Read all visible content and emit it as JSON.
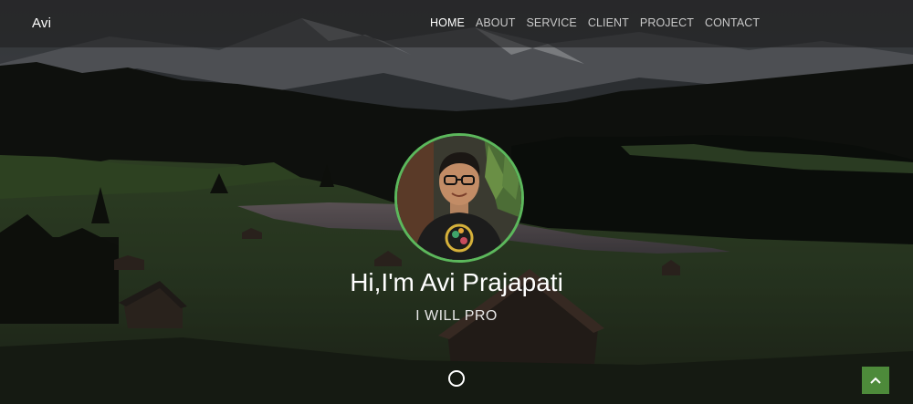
{
  "brand": "Avi",
  "nav": {
    "items": [
      {
        "label": "HOME",
        "active": true
      },
      {
        "label": "ABOUT",
        "active": false
      },
      {
        "label": "SERVICE",
        "active": false
      },
      {
        "label": "CLIENT",
        "active": false
      },
      {
        "label": "PROJECT",
        "active": false
      },
      {
        "label": "CONTACT",
        "active": false
      }
    ]
  },
  "hero": {
    "title": "Hi,I'm Avi Prajapati",
    "subtitle": "I WILL PRO"
  },
  "icons": {
    "avatar": "profile-photo",
    "scroll": "circle-icon",
    "back_to_top": "chevron-up-icon"
  },
  "colors": {
    "accent": "#5cb85c",
    "back_to_top_bg": "#4d8a3a",
    "nav_active": "#ffffff",
    "nav_inactive": "#c9c9c9"
  }
}
